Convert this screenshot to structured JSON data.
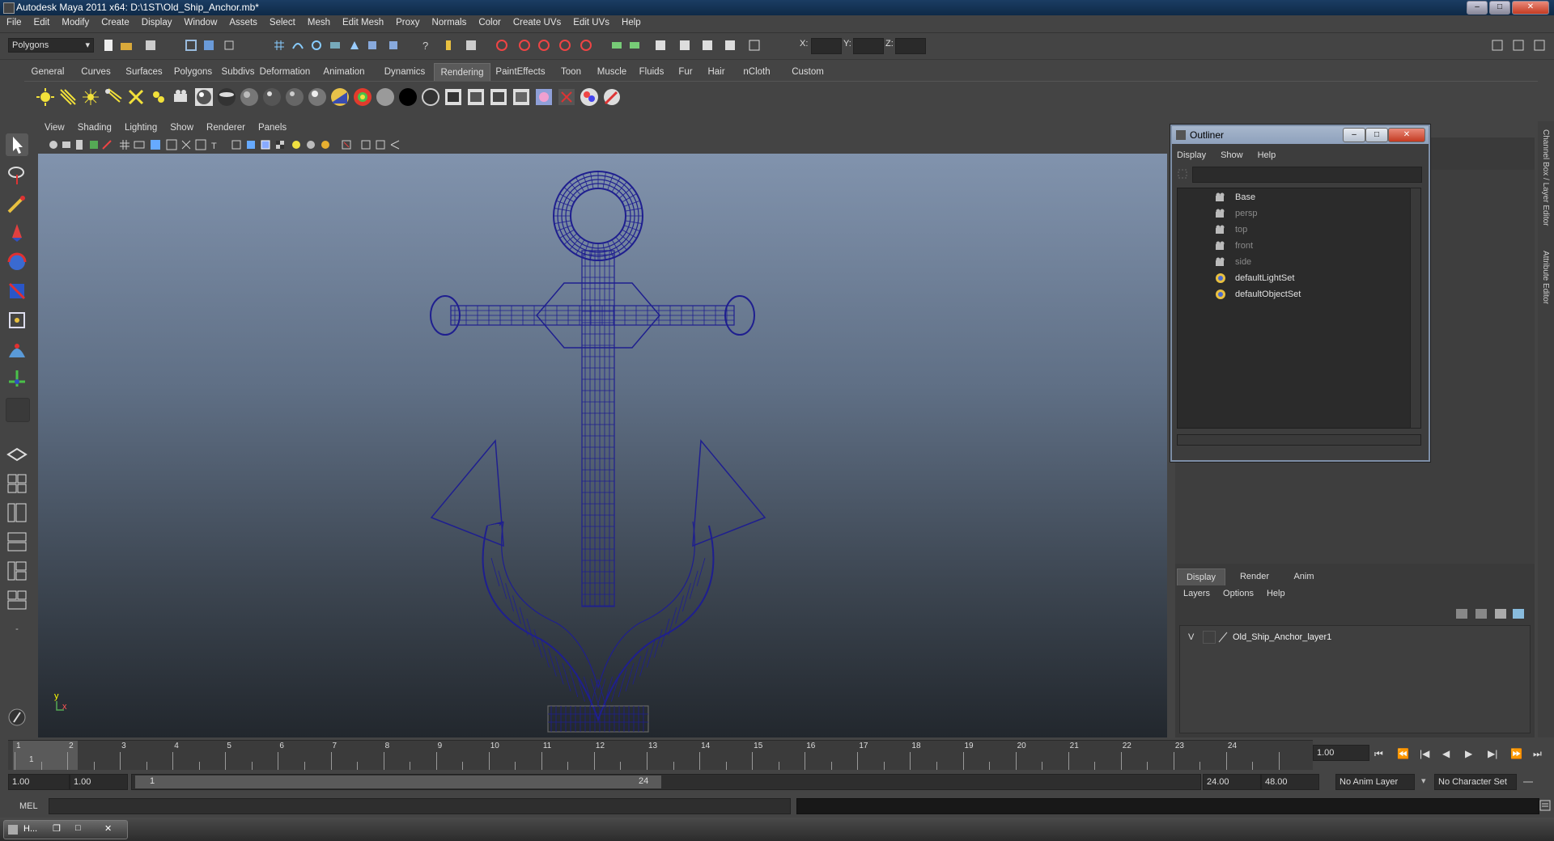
{
  "window": {
    "title": "Autodesk Maya 2011 x64: D:\\1ST\\Old_Ship_Anchor.mb*"
  },
  "menubar": [
    "File",
    "Edit",
    "Modify",
    "Create",
    "Display",
    "Window",
    "Assets",
    "Select",
    "Mesh",
    "Edit Mesh",
    "Proxy",
    "Normals",
    "Color",
    "Create UVs",
    "Edit UVs",
    "Help"
  ],
  "statusline": {
    "mode": "Polygons",
    "x_label": "X:",
    "y_label": "Y:",
    "z_label": "Z:"
  },
  "shelf_tabs": [
    "General",
    "Curves",
    "Surfaces",
    "Polygons",
    "Subdivs",
    "Deformation",
    "Animation",
    "Dynamics",
    "Rendering",
    "PaintEffects",
    "Toon",
    "Muscle",
    "Fluids",
    "Fur",
    "Hair",
    "nCloth",
    "Custom"
  ],
  "shelf_active": "Rendering",
  "viewport": {
    "menu": [
      "View",
      "Shading",
      "Lighting",
      "Show",
      "Renderer",
      "Panels"
    ],
    "axis_y": "y",
    "axis_x": "x",
    "wire_color": "#1f1f8f"
  },
  "outliner": {
    "title": "Outliner",
    "menu": [
      "Display",
      "Show",
      "Help"
    ],
    "items": [
      {
        "label": "Base",
        "dim": false,
        "icon": "camera-icon"
      },
      {
        "label": "persp",
        "dim": true,
        "icon": "camera-icon"
      },
      {
        "label": "top",
        "dim": true,
        "icon": "camera-icon"
      },
      {
        "label": "front",
        "dim": true,
        "icon": "camera-icon"
      },
      {
        "label": "side",
        "dim": true,
        "icon": "camera-icon"
      },
      {
        "label": "defaultLightSet",
        "dim": false,
        "icon": "set-icon"
      },
      {
        "label": "defaultObjectSet",
        "dim": false,
        "icon": "set-icon"
      }
    ]
  },
  "side_tabs": {
    "channel_box": "Channel Box / Layer Editor",
    "attribute_editor": "Attribute Editor"
  },
  "layer_editor": {
    "tabs": [
      "Display",
      "Render",
      "Anim"
    ],
    "active_tab": "Display",
    "menu": [
      "Layers",
      "Options",
      "Help"
    ],
    "layer": {
      "visible": "V",
      "name": "Old_Ship_Anchor_layer1"
    }
  },
  "timeline": {
    "ticks": [
      "1",
      "2",
      "3",
      "4",
      "5",
      "6",
      "7",
      "8",
      "9",
      "10",
      "11",
      "12",
      "13",
      "14",
      "15",
      "16",
      "17",
      "18",
      "19",
      "20",
      "21",
      "22",
      "23",
      "24"
    ],
    "current": "1",
    "current_field": "1.00"
  },
  "range": {
    "start": "1.00",
    "anim_start": "1.00",
    "slider_start": "1",
    "slider_end": "24",
    "anim_end": "24.00",
    "end": "48.00",
    "anim_layer": "No Anim Layer",
    "character_set": "No Character Set"
  },
  "command": {
    "label": "MEL"
  },
  "taskbar": {
    "item": "H..."
  }
}
